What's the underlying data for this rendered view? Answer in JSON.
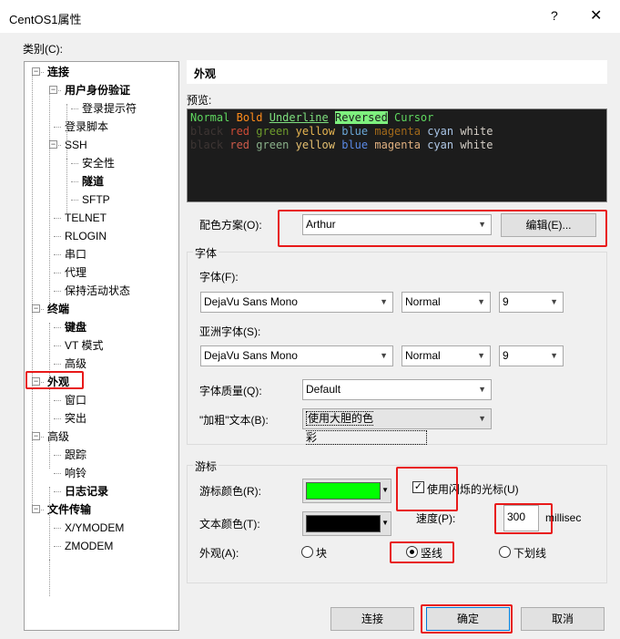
{
  "window": {
    "title": "CentOS1属性",
    "help": "?",
    "close": "✕"
  },
  "category_label": "类别(C):",
  "tree": [
    {
      "label": "连接",
      "level": 0,
      "bold": true,
      "expander": "−"
    },
    {
      "label": "用户身份验证",
      "level": 1,
      "bold": true,
      "expander": "−"
    },
    {
      "label": "登录提示符",
      "level": 2
    },
    {
      "label": "登录脚本",
      "level": 1
    },
    {
      "label": "SSH",
      "level": 1,
      "expander": "−"
    },
    {
      "label": "安全性",
      "level": 2
    },
    {
      "label": "隧道",
      "level": 2,
      "bold": true
    },
    {
      "label": "SFTP",
      "level": 2
    },
    {
      "label": "TELNET",
      "level": 1
    },
    {
      "label": "RLOGIN",
      "level": 1
    },
    {
      "label": "串口",
      "level": 1
    },
    {
      "label": "代理",
      "level": 1
    },
    {
      "label": "保持活动状态",
      "level": 1
    },
    {
      "label": "终端",
      "level": 0,
      "bold": true,
      "expander": "−"
    },
    {
      "label": "键盘",
      "level": 1,
      "bold": true
    },
    {
      "label": "VT 模式",
      "level": 1
    },
    {
      "label": "高级",
      "level": 1
    },
    {
      "label": "外观",
      "level": 0,
      "bold": true,
      "expander": "−",
      "selected": true
    },
    {
      "label": "窗口",
      "level": 1
    },
    {
      "label": "突出",
      "level": 1
    },
    {
      "label": "高级",
      "level": 0,
      "expander": "−"
    },
    {
      "label": "跟踪",
      "level": 1
    },
    {
      "label": "响铃",
      "level": 1
    },
    {
      "label": "日志记录",
      "level": 1,
      "bold": true
    },
    {
      "label": "文件传输",
      "level": 0,
      "bold": true,
      "expander": "−"
    },
    {
      "label": "X/YMODEM",
      "level": 1
    },
    {
      "label": "ZMODEM",
      "level": 1
    }
  ],
  "panel": {
    "header": "外观",
    "preview_label": "预览:",
    "preview": {
      "line1": [
        {
          "t": "Normal",
          "c": "#5fd75f"
        },
        {
          "t": "Bold",
          "c": "#ff8c1a"
        },
        {
          "t": "Underline",
          "c": "#7ee07e",
          "u": true
        },
        {
          "t": "Reversed",
          "c": "#1c1c1c",
          "bg": "#7ef07e"
        },
        {
          "t": "Cursor",
          "c": "#5fd75f"
        }
      ],
      "line2": [
        {
          "t": "black",
          "c": "#3d3533"
        },
        {
          "t": "red",
          "c": "#cc4a35"
        },
        {
          "t": "green",
          "c": "#6e9c2c"
        },
        {
          "t": "yellow",
          "c": "#e6b450"
        },
        {
          "t": "blue",
          "c": "#6aa6d6"
        },
        {
          "t": "magenta",
          "c": "#a36a1a"
        },
        {
          "t": "cyan",
          "c": "#a8c4e6"
        },
        {
          "t": "white",
          "c": "#d6d0c8"
        }
      ],
      "line3": [
        {
          "t": "black",
          "c": "#3d3533"
        },
        {
          "t": "red",
          "c": "#cc5a4a"
        },
        {
          "t": "green",
          "c": "#8ab08a"
        },
        {
          "t": "yellow",
          "c": "#e6c070"
        },
        {
          "t": "blue",
          "c": "#5a8ae6"
        },
        {
          "t": "magenta",
          "c": "#e0b080"
        },
        {
          "t": "cyan",
          "c": "#b0c8e6"
        },
        {
          "t": "white",
          "c": "#d6d0c8"
        }
      ]
    },
    "scheme_label": "配色方案(O):",
    "scheme_value": "Arthur",
    "edit_button": "编辑(E)...",
    "font_group": "字体",
    "font_label": "字体(F):",
    "font_value": "DejaVu Sans Mono",
    "font_weight": "Normal",
    "font_size": "9",
    "asian_font_label": "亚洲字体(S):",
    "asian_font_value": "DejaVu Sans Mono",
    "asian_font_weight": "Normal",
    "asian_font_size": "9",
    "quality_label": "字体质量(Q):",
    "quality_value": "Default",
    "bold_label": "\"加粗\"文本(B):",
    "bold_value": "使用大胆的色彩",
    "cursor_group": "游标",
    "cursor_color_label": "游标颜色(R):",
    "cursor_color": "#00ff00",
    "text_color_label": "文本颜色(T):",
    "text_color": "#000000",
    "blink_label": "使用闪烁的光标(U)",
    "blink_checked": true,
    "speed_label": "速度(P):",
    "speed_value": "300",
    "speed_unit": "millisec",
    "appearance_label": "外观(A):",
    "shape_options": [
      "块",
      "竖线",
      "下划线"
    ],
    "shape_selected": "竖线"
  },
  "buttons": {
    "connect": "连接",
    "ok": "确定",
    "cancel": "取消"
  }
}
